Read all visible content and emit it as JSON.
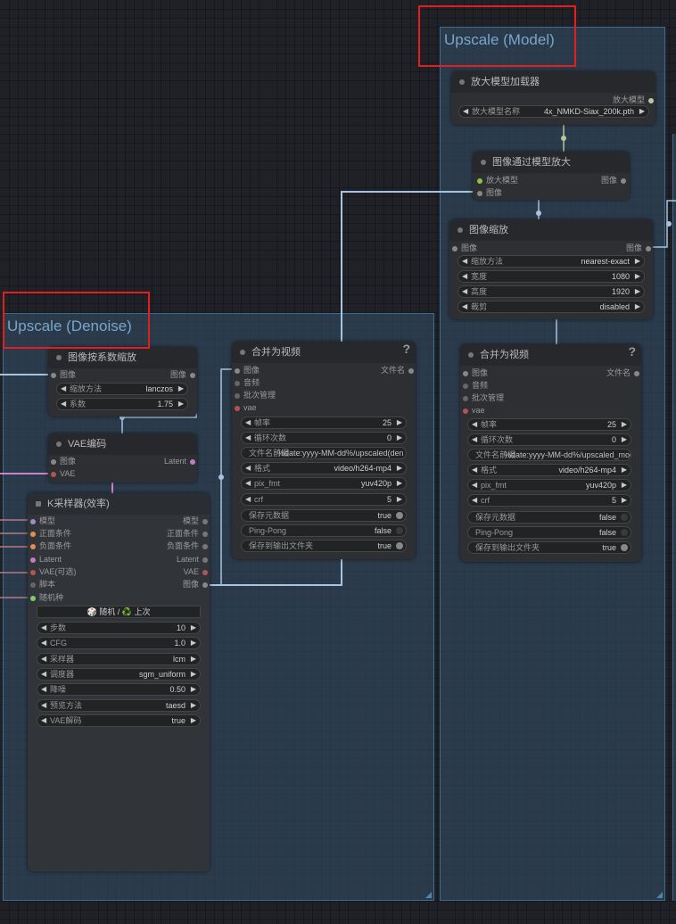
{
  "groups": {
    "model": {
      "title": "Upscale (Model)"
    },
    "denoise": {
      "title": "Upscale (Denoise)"
    }
  },
  "nodes": {
    "model_loader": {
      "title": "放大模型加载器",
      "output": "放大模型",
      "model_name": {
        "label": "放大模型名称",
        "value": "4x_NMKD-Siax_200k.pth"
      }
    },
    "upscale_by_model": {
      "title": "图像通过模型放大",
      "input_model": "放大模型",
      "input_image": "图像",
      "output": "图像"
    },
    "image_scale": {
      "title": "图像缩放",
      "input": "图像",
      "output": "图像",
      "widgets": [
        {
          "label": "缩放方法",
          "value": "nearest-exact"
        },
        {
          "label": "宽度",
          "value": "1080"
        },
        {
          "label": "高度",
          "value": "1920"
        },
        {
          "label": "裁剪",
          "value": "disabled"
        }
      ]
    },
    "video_right": {
      "title": "合并为视频",
      "help": "?",
      "output": "文件名",
      "inputs": [
        "图像",
        "音频",
        "批次管理",
        "vae"
      ],
      "widgets": [
        {
          "label": "帧率",
          "value": "25"
        },
        {
          "label": "循环次数",
          "value": "0"
        }
      ],
      "filename": {
        "label": "文件名前缀",
        "value": "%date:yyyy-MM-dd%/upscaled_mod"
      },
      "widgets2": [
        {
          "label": "格式",
          "value": "video/h264-mp4"
        },
        {
          "label": "pix_fmt",
          "value": "yuv420p"
        },
        {
          "label": "crf",
          "value": "5"
        }
      ],
      "toggles": [
        {
          "label": "保存元数据",
          "value": "false"
        },
        {
          "label": "Ping-Pong",
          "value": "false"
        },
        {
          "label": "保存到输出文件夹",
          "value": "true"
        }
      ]
    },
    "scale_by": {
      "title": "图像按系数缩放",
      "input": "图像",
      "output": "图像",
      "widgets": [
        {
          "label": "缩放方法",
          "value": "lanczos"
        },
        {
          "label": "系数",
          "value": "1.75"
        }
      ]
    },
    "vae_encode": {
      "title": "VAE编码",
      "input_image": "图像",
      "input_vae": "VAE",
      "output": "Latent"
    },
    "ksampler": {
      "title": "K采样器(效率)",
      "inputs": [
        "模型",
        "正面条件",
        "负面条件",
        "Latent",
        "VAE(可选)",
        "脚本",
        "随机种"
      ],
      "outputs": [
        "模型",
        "正面条件",
        "负面条件",
        "Latent",
        "VAE",
        "图像"
      ],
      "seed_button": "🎲 随机 / ♻️ 上次",
      "widgets": [
        {
          "label": "步数",
          "value": "10"
        },
        {
          "label": "CFG",
          "value": "1.0"
        },
        {
          "label": "采样器",
          "value": "lcm"
        },
        {
          "label": "调度器",
          "value": "sgm_uniform"
        },
        {
          "label": "降噪",
          "value": "0.50"
        },
        {
          "label": "预览方法",
          "value": "taesd"
        },
        {
          "label": "VAE解码",
          "value": "true"
        }
      ]
    },
    "video_left": {
      "title": "合并为视频",
      "help": "?",
      "output": "文件名",
      "inputs": [
        "图像",
        "音频",
        "批次管理",
        "vae"
      ],
      "widgets": [
        {
          "label": "帧率",
          "value": "25"
        },
        {
          "label": "循环次数",
          "value": "0"
        }
      ],
      "filename": {
        "label": "文件名前缀",
        "value": "%date:yyyy-MM-dd%/upscaled(den"
      },
      "widgets2": [
        {
          "label": "格式",
          "value": "video/h264-mp4"
        },
        {
          "label": "pix_fmt",
          "value": "yuv420p"
        },
        {
          "label": "crf",
          "value": "5"
        }
      ],
      "toggles": [
        {
          "label": "保存元数据",
          "value": "true"
        },
        {
          "label": "Ping-Pong",
          "value": "false"
        },
        {
          "label": "保存到输出文件夹",
          "value": "true"
        }
      ]
    }
  },
  "colors": {
    "group_fill": "#35526b",
    "group_title": "#78a6cc",
    "highlight": "#e02020",
    "wire_image": "#a6c4e0",
    "wire_model": "#b8c7a0",
    "wire_latent": "#ff9cf9",
    "wire_vae": "#ff6e6e"
  }
}
